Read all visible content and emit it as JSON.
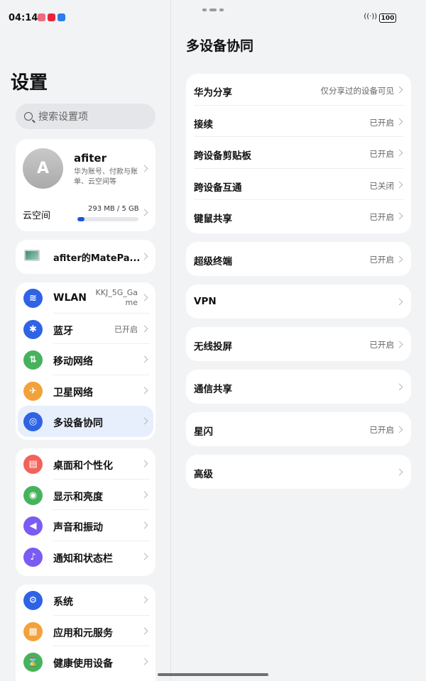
{
  "status_bar": {
    "time": "04:14",
    "battery": "100"
  },
  "left": {
    "title": "设置",
    "search_placeholder": "搜索设置项",
    "account": {
      "avatar_letter": "A",
      "name": "afiter",
      "subtitle": "华为账号、付款与账单、云空间等",
      "cloud_label": "云空间",
      "cloud_usage": "293 MB / 5 GB",
      "cloud_fraction": 0.06
    },
    "device": {
      "label": "afiter的MatePa..."
    },
    "group1": [
      {
        "label": "WLAN",
        "value": "KKJ_5G_Game",
        "icon": "wifi-icon",
        "color": "#2f63e6"
      },
      {
        "label": "蓝牙",
        "value": "已开启",
        "icon": "bluetooth-icon",
        "color": "#2f63e6"
      },
      {
        "label": "移动网络",
        "value": "",
        "icon": "mobile-network-icon",
        "color": "#46b35c"
      },
      {
        "label": "卫星网络",
        "value": "",
        "icon": "satellite-icon",
        "color": "#f2a23a"
      },
      {
        "label": "多设备协同",
        "value": "",
        "icon": "multi-device-icon",
        "color": "#2f63e6",
        "selected": true
      }
    ],
    "group2": [
      {
        "label": "桌面和个性化",
        "icon": "brush-icon",
        "color": "#f2625a"
      },
      {
        "label": "显示和亮度",
        "icon": "eye-icon",
        "color": "#46b35c"
      },
      {
        "label": "声音和振动",
        "icon": "speaker-icon",
        "color": "#7a5cf2"
      },
      {
        "label": "通知和状态栏",
        "icon": "bell-icon",
        "color": "#7a5cf2"
      }
    ],
    "group3": [
      {
        "label": "系统",
        "icon": "gear-icon",
        "color": "#2f63e6"
      },
      {
        "label": "应用和元服务",
        "icon": "apps-icon",
        "color": "#f2a23a"
      },
      {
        "label": "健康使用设备",
        "icon": "hourglass-icon",
        "color": "#46b35c"
      }
    ]
  },
  "right": {
    "title": "多设备协同",
    "card1": [
      {
        "label": "华为分享",
        "value": "仅分享过的设备可见"
      },
      {
        "label": "接续",
        "value": "已开启"
      },
      {
        "label": "跨设备剪贴板",
        "value": "已开启"
      },
      {
        "label": "跨设备互通",
        "value": "已关闭"
      },
      {
        "label": "键鼠共享",
        "value": "已开启"
      }
    ],
    "singles": [
      {
        "label": "超级终端",
        "value": "已开启"
      },
      {
        "label": "VPN",
        "value": ""
      },
      {
        "label": "无线投屏",
        "value": "已开启"
      },
      {
        "label": "通信共享",
        "value": ""
      },
      {
        "label": "星闪",
        "value": "已开启"
      },
      {
        "label": "高级",
        "value": ""
      }
    ]
  }
}
